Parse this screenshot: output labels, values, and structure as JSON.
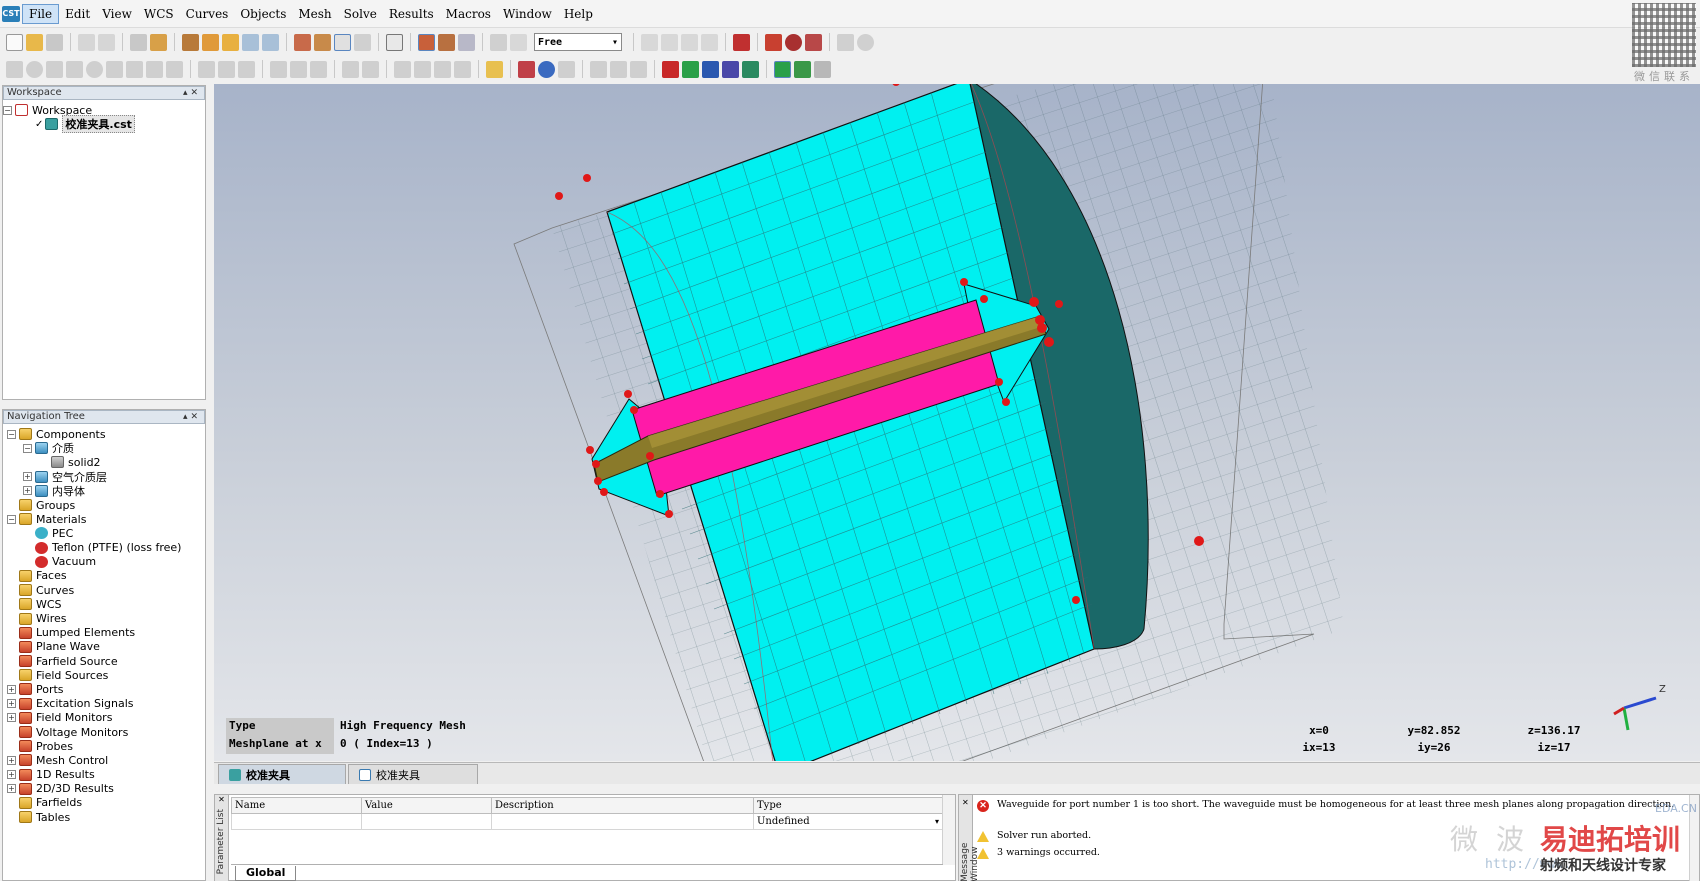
{
  "menu": {
    "logo": "CST",
    "items": [
      "File",
      "Edit",
      "View",
      "WCS",
      "Curves",
      "Objects",
      "Mesh",
      "Solve",
      "Results",
      "Macros",
      "Window",
      "Help"
    ]
  },
  "toolbar": {
    "mode_select": "Free"
  },
  "watermark_qr_caption": "微信联系",
  "workspace": {
    "header": "Workspace",
    "root": "Workspace",
    "file": "校准夹具.cst"
  },
  "nav_tree": {
    "header": "Navigation Tree",
    "items": [
      {
        "label": "Components",
        "level": 0,
        "exp": "−",
        "icon": "ic-folder"
      },
      {
        "label": "介质",
        "level": 1,
        "exp": "−",
        "icon": "ic-comp"
      },
      {
        "label": "solid2",
        "level": 2,
        "exp": "",
        "icon": "ic-solid"
      },
      {
        "label": "空气介质层",
        "level": 1,
        "exp": "+",
        "icon": "ic-comp"
      },
      {
        "label": "内导体",
        "level": 1,
        "exp": "+",
        "icon": "ic-comp"
      },
      {
        "label": "Groups",
        "level": 0,
        "exp": "",
        "icon": "ic-folder"
      },
      {
        "label": "Materials",
        "level": 0,
        "exp": "−",
        "icon": "ic-folder"
      },
      {
        "label": "PEC",
        "level": 1,
        "exp": "",
        "icon": "ic-mat-pec"
      },
      {
        "label": "Teflon (PTFE) (loss free)",
        "level": 1,
        "exp": "",
        "icon": "ic-mat-red"
      },
      {
        "label": "Vacuum",
        "level": 1,
        "exp": "",
        "icon": "ic-mat-red"
      },
      {
        "label": "Faces",
        "level": 0,
        "exp": "",
        "icon": "ic-folder"
      },
      {
        "label": "Curves",
        "level": 0,
        "exp": "",
        "icon": "ic-folder"
      },
      {
        "label": "WCS",
        "level": 0,
        "exp": "",
        "icon": "ic-folder"
      },
      {
        "label": "Wires",
        "level": 0,
        "exp": "",
        "icon": "ic-folder"
      },
      {
        "label": "Lumped Elements",
        "level": 0,
        "exp": "",
        "icon": "ic-red"
      },
      {
        "label": "Plane Wave",
        "level": 0,
        "exp": "",
        "icon": "ic-red"
      },
      {
        "label": "Farfield Source",
        "level": 0,
        "exp": "",
        "icon": "ic-red"
      },
      {
        "label": "Field Sources",
        "level": 0,
        "exp": "",
        "icon": "ic-folder"
      },
      {
        "label": "Ports",
        "level": 0,
        "exp": "+",
        "icon": "ic-red"
      },
      {
        "label": "Excitation Signals",
        "level": 0,
        "exp": "+",
        "icon": "ic-red"
      },
      {
        "label": "Field Monitors",
        "level": 0,
        "exp": "+",
        "icon": "ic-red"
      },
      {
        "label": "Voltage Monitors",
        "level": 0,
        "exp": "",
        "icon": "ic-red"
      },
      {
        "label": "Probes",
        "level": 0,
        "exp": "",
        "icon": "ic-red"
      },
      {
        "label": "Mesh Control",
        "level": 0,
        "exp": "+",
        "icon": "ic-red"
      },
      {
        "label": "1D Results",
        "level": 0,
        "exp": "+",
        "icon": "ic-red"
      },
      {
        "label": "2D/3D Results",
        "level": 0,
        "exp": "+",
        "icon": "ic-red"
      },
      {
        "label": "Farfields",
        "level": 0,
        "exp": "",
        "icon": "ic-folder"
      },
      {
        "label": "Tables",
        "level": 0,
        "exp": "",
        "icon": "ic-folder"
      }
    ]
  },
  "viewport": {
    "info": {
      "type_label": "Type",
      "type_value": "High Frequency Mesh",
      "meshplane_label": "Meshplane at x",
      "meshplane_value": "0 ( Index=13 )"
    },
    "coords": {
      "x": "x=0",
      "y": "y=82.852",
      "z": "z=136.17",
      "ix": "ix=13",
      "iy": "iy=26",
      "iz": "iz=17"
    },
    "axis_label": "Z",
    "colors": {
      "dielectric": "#00f0f0",
      "dielectric_side": "#1a6868",
      "air_layer": "#ff1aa8",
      "inner_conductor": "#8a7a2a",
      "vertex": "#e01818"
    }
  },
  "doc_tabs": [
    {
      "label": "校准夹具",
      "active": true
    },
    {
      "label": "校准夹具",
      "active": false
    }
  ],
  "params": {
    "side_label": "Parameter List",
    "columns": [
      "Name",
      "Value",
      "Description",
      "Type"
    ],
    "type_value": "Undefined",
    "footer_tab": "Global"
  },
  "messages": {
    "side_label": "Message Window",
    "items": [
      {
        "level": "error",
        "text": "Waveguide for port number 1 is too short. The waveguide must be homogeneous for at least three mesh planes along propagation direction."
      },
      {
        "level": "warning",
        "text": "Solver run aborted."
      },
      {
        "level": "warning",
        "text": "3 warnings occurred."
      }
    ]
  },
  "watermark": {
    "text_gray": "微波",
    "text_red": "易迪拓培训",
    "url": "http://www.",
    "tagline": "射频和天线设计专家",
    "small": "EDA.CN"
  }
}
